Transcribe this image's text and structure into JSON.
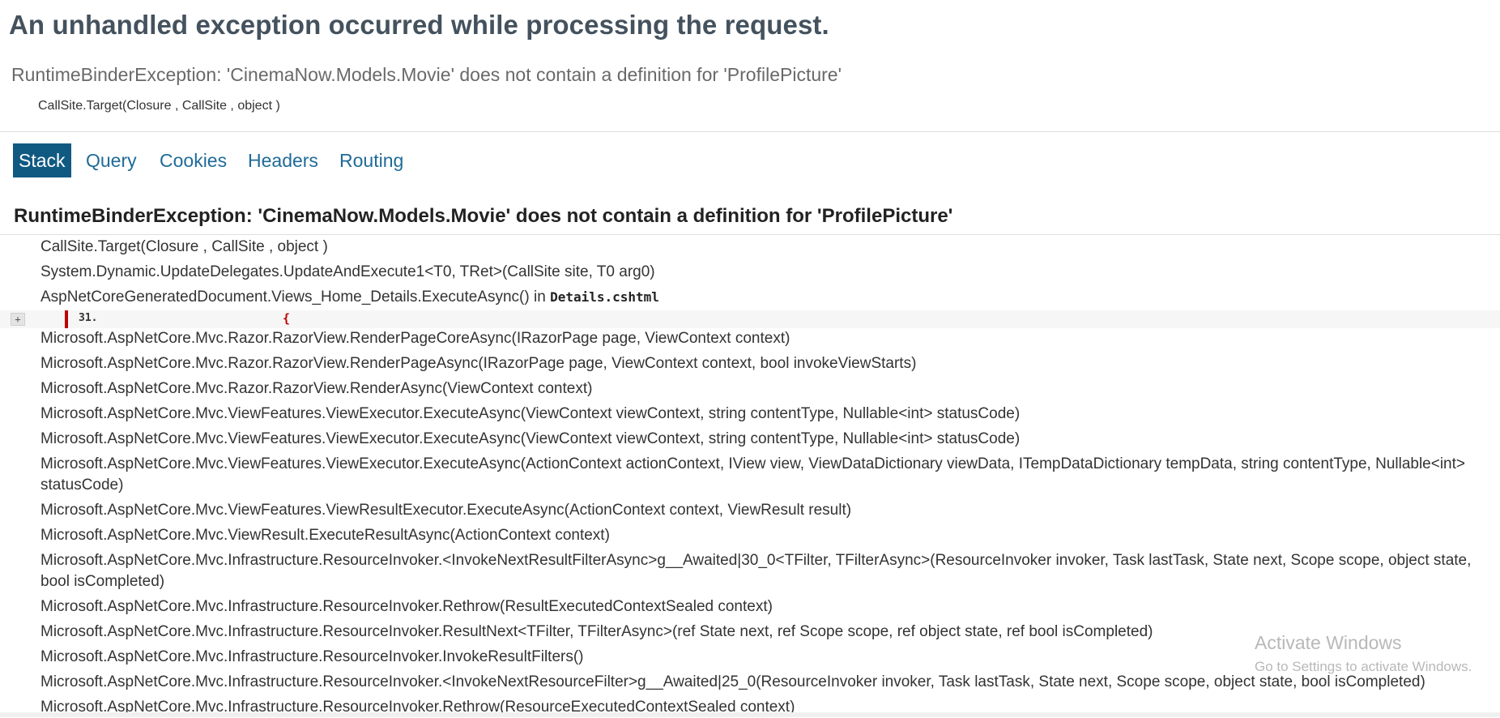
{
  "page": {
    "title": "An unhandled exception occurred while processing the request.",
    "error_message": "RuntimeBinderException: 'CinemaNow.Models.Movie' does not contain a definition for 'ProfilePicture'",
    "error_location": "CallSite.Target(Closure , CallSite , object )"
  },
  "tabs": [
    {
      "label": "Stack",
      "selected": true
    },
    {
      "label": "Query",
      "selected": false
    },
    {
      "label": "Cookies",
      "selected": false
    },
    {
      "label": "Headers",
      "selected": false
    },
    {
      "label": "Routing",
      "selected": false
    }
  ],
  "stack": {
    "header": "RuntimeBinderException: 'CinemaNow.Models.Movie' does not contain a definition for 'ProfilePicture'",
    "frames": [
      {
        "method": "CallSite.Target(Closure , CallSite , object )"
      },
      {
        "method": "System.Dynamic.UpdateDelegates.UpdateAndExecute1<T0, TRet>(CallSite site, T0 arg0)"
      },
      {
        "method": "AspNetCoreGeneratedDocument.Views_Home_Details.ExecuteAsync() in ",
        "file": "Details.cshtml"
      },
      {
        "method": "Microsoft.AspNetCore.Mvc.Razor.RazorView.RenderPageCoreAsync(IRazorPage page, ViewContext context)"
      },
      {
        "method": "Microsoft.AspNetCore.Mvc.Razor.RazorView.RenderPageAsync(IRazorPage page, ViewContext context, bool invokeViewStarts)"
      },
      {
        "method": "Microsoft.AspNetCore.Mvc.Razor.RazorView.RenderAsync(ViewContext context)"
      },
      {
        "method": "Microsoft.AspNetCore.Mvc.ViewFeatures.ViewExecutor.ExecuteAsync(ViewContext viewContext, string contentType, Nullable<int> statusCode)"
      },
      {
        "method": "Microsoft.AspNetCore.Mvc.ViewFeatures.ViewExecutor.ExecuteAsync(ViewContext viewContext, string contentType, Nullable<int> statusCode)"
      },
      {
        "method": "Microsoft.AspNetCore.Mvc.ViewFeatures.ViewExecutor.ExecuteAsync(ActionContext actionContext, IView view, ViewDataDictionary viewData, ITempDataDictionary tempData, string contentType, Nullable<int> statusCode)"
      },
      {
        "method": "Microsoft.AspNetCore.Mvc.ViewFeatures.ViewResultExecutor.ExecuteAsync(ActionContext context, ViewResult result)"
      },
      {
        "method": "Microsoft.AspNetCore.Mvc.ViewResult.ExecuteResultAsync(ActionContext context)"
      },
      {
        "method": "Microsoft.AspNetCore.Mvc.Infrastructure.ResourceInvoker.<InvokeNextResultFilterAsync>g__Awaited|30_0<TFilter, TFilterAsync>(ResourceInvoker invoker, Task lastTask, State next, Scope scope, object state, bool isCompleted)"
      },
      {
        "method": "Microsoft.AspNetCore.Mvc.Infrastructure.ResourceInvoker.Rethrow(ResultExecutedContextSealed context)"
      },
      {
        "method": "Microsoft.AspNetCore.Mvc.Infrastructure.ResourceInvoker.ResultNext<TFilter, TFilterAsync>(ref State next, ref Scope scope, ref object state, ref bool isCompleted)"
      },
      {
        "method": "Microsoft.AspNetCore.Mvc.Infrastructure.ResourceInvoker.InvokeResultFilters()"
      },
      {
        "method": "Microsoft.AspNetCore.Mvc.Infrastructure.ResourceInvoker.<InvokeNextResourceFilter>g__Awaited|25_0(ResourceInvoker invoker, Task lastTask, State next, Scope scope, object state, bool isCompleted)"
      },
      {
        "method": "Microsoft.AspNetCore.Mvc.Infrastructure.ResourceInvoker.Rethrow(ResourceExecutedContextSealed context)"
      }
    ],
    "source_line": {
      "expander_label": "+",
      "line_number": "31.",
      "code": "{"
    }
  },
  "watermark": {
    "line1": "Activate Windows",
    "line2": "Go to Settings to activate Windows."
  }
}
